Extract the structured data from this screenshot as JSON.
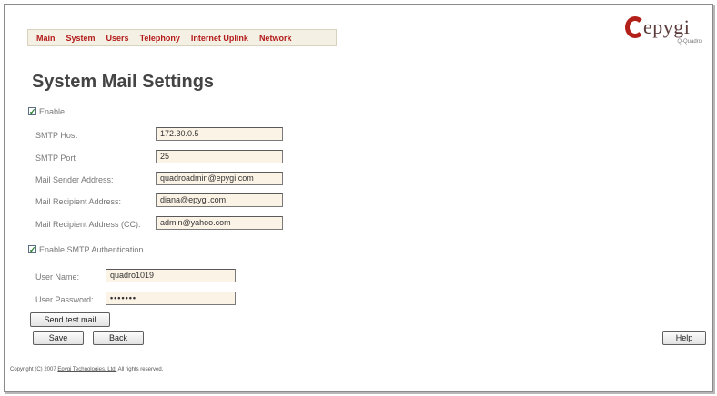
{
  "nav": {
    "items": [
      "Main",
      "System",
      "Users",
      "Telephony",
      "Internet Uplink",
      "Network"
    ]
  },
  "logo": {
    "word": "epygi",
    "sub": "Q-Quadro"
  },
  "page": {
    "title": "System Mail Settings"
  },
  "form": {
    "enable": {
      "label": "Enable",
      "checked": true
    },
    "smtp_host": {
      "label": "SMTP Host",
      "value": "172.30.0.5"
    },
    "smtp_port": {
      "label": "SMTP Port",
      "value": "25"
    },
    "sender": {
      "label": "Mail Sender Address:",
      "value": "quadroadmin@epygi.com"
    },
    "recipient": {
      "label": "Mail Recipient Address:",
      "value": "diana@epygi.com"
    },
    "recipient_cc": {
      "label": "Mail Recipient Address (CC):",
      "value": "admin@yahoo.com"
    },
    "smtp_auth": {
      "label": "Enable SMTP Authentication",
      "checked": true
    },
    "user_name": {
      "label": "User Name:",
      "value": "quadro1019"
    },
    "user_password": {
      "label": "User Password:",
      "value": "•••••••"
    }
  },
  "buttons": {
    "send_test": "Send test mail",
    "save": "Save",
    "back": "Back",
    "help": "Help"
  },
  "footer": {
    "prefix": "Copyright (C) 2007 ",
    "link": "Epygi Technologies, Ltd.",
    "suffix": " All rights reserved."
  }
}
